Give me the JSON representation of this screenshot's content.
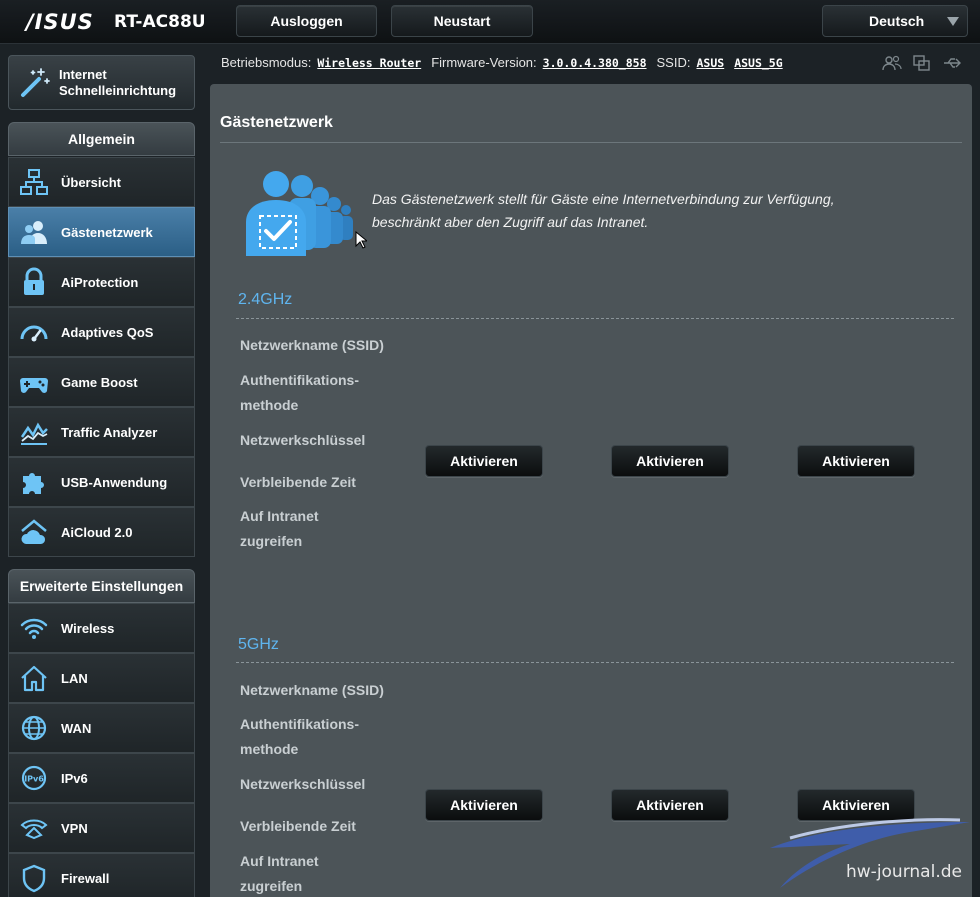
{
  "header": {
    "brand": "/ISUS",
    "model": "RT-AC88U",
    "logout_label": "Ausloggen",
    "reboot_label": "Neustart",
    "language": "Deutsch"
  },
  "status": {
    "mode_label": "Betriebsmodus:",
    "mode_value": "Wireless Router",
    "firmware_label": "Firmware-Version:",
    "firmware_value": "3.0.0.4.380_858",
    "ssid_label": "SSID:",
    "ssid_1": "ASUS",
    "ssid_2": "ASUS_5G"
  },
  "sidebar": {
    "quick_setup": "Internet Schnelleinrichtung",
    "general_title": "Allgemein",
    "general": [
      {
        "label": "Übersicht",
        "icon": "network-map-icon"
      },
      {
        "label": "Gästenetzwerk",
        "icon": "guest-network-icon"
      },
      {
        "label": "AiProtection",
        "icon": "lock-icon"
      },
      {
        "label": "Adaptives QoS",
        "icon": "speedometer-icon"
      },
      {
        "label": "Game Boost",
        "icon": "gamepad-icon"
      },
      {
        "label": "Traffic Analyzer",
        "icon": "traffic-chart-icon"
      },
      {
        "label": "USB-Anwendung",
        "icon": "puzzle-icon"
      },
      {
        "label": "AiCloud 2.0",
        "icon": "cloud-home-icon"
      }
    ],
    "advanced_title": "Erweiterte Einstellungen",
    "advanced": [
      {
        "label": "Wireless",
        "icon": "wifi-icon"
      },
      {
        "label": "LAN",
        "icon": "home-icon"
      },
      {
        "label": "WAN",
        "icon": "globe-icon"
      },
      {
        "label": "IPv6",
        "icon": "ipv6-globe-icon"
      },
      {
        "label": "VPN",
        "icon": "vpn-icon"
      },
      {
        "label": "Firewall",
        "icon": "shield-icon"
      }
    ]
  },
  "main": {
    "title": "Gästenetzwerk",
    "intro": "Das Gästenetzwerk stellt für Gäste eine Internetverbindung zur Verfügung, beschränkt aber den Zugriff auf das Intranet.",
    "bands": [
      {
        "name": "2.4GHz",
        "fields": [
          "Netzwerkname (SSID)",
          "Authentifikations-methode",
          "Netzwerkschlüssel",
          "Verbleibende Zeit",
          "Auf Intranet zugreifen"
        ],
        "button_label": "Aktivieren"
      },
      {
        "name": "5GHz",
        "fields": [
          "Netzwerkname (SSID)",
          "Authentifikations-methode",
          "Netzwerkschlüssel",
          "Verbleibende Zeit",
          "Auf Intranet zugreifen"
        ],
        "button_label": "Aktivieren"
      }
    ]
  },
  "watermark": "hw-journal.de",
  "colors": {
    "accent_blue": "#5fb5ef",
    "active_menu": "#3b6f96",
    "panel": "#4c5458"
  }
}
